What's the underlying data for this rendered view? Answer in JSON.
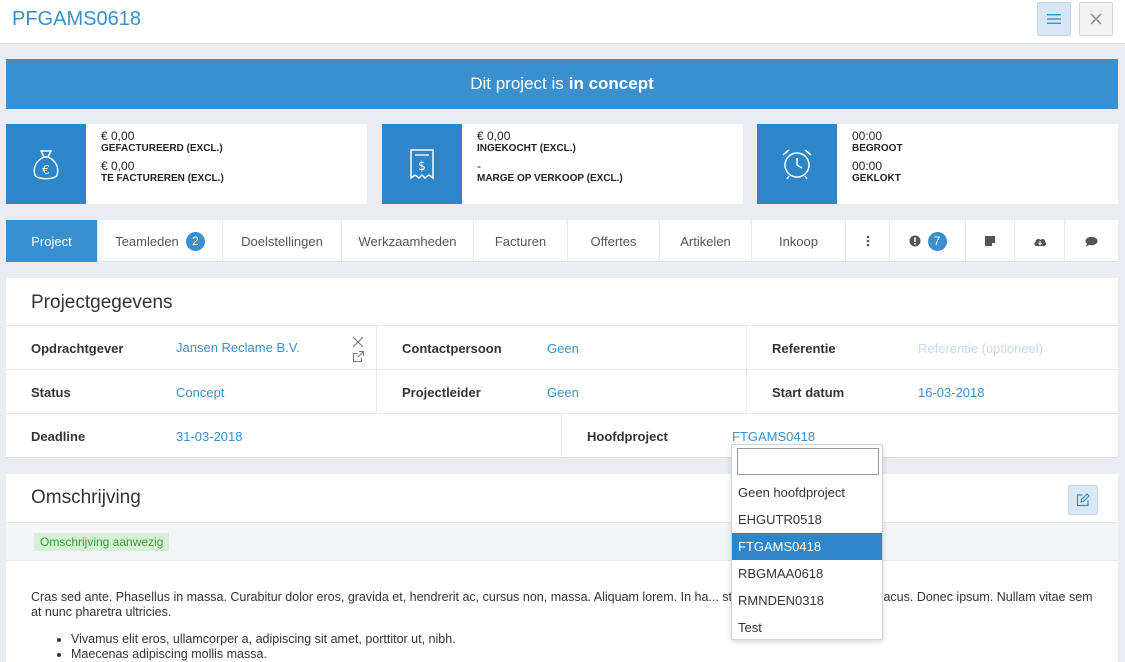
{
  "header": {
    "title": "PFGAMS0618"
  },
  "banner": {
    "prefix": "Dit project is",
    "status": "in concept"
  },
  "stats": [
    {
      "icon": "money-bag-icon",
      "rows": [
        {
          "value": "€ 0,00",
          "label": "GEFACTUREERD (EXCL.)"
        },
        {
          "value": "€ 0,00",
          "label": "TE FACTUREREN (EXCL.)"
        }
      ]
    },
    {
      "icon": "receipt-icon",
      "rows": [
        {
          "value": "€ 0,00",
          "label": "INGEKOCHT (EXCL.)"
        },
        {
          "value": "-",
          "label": "MARGE OP VERKOOP (EXCL.)"
        }
      ]
    },
    {
      "icon": "alarm-clock-icon",
      "rows": [
        {
          "value": "00:00",
          "label": "BEGROOT"
        },
        {
          "value": "00:00",
          "label": "GEKLOKT"
        }
      ]
    }
  ],
  "tabs": [
    {
      "label": "Project"
    },
    {
      "label": "Teamleden",
      "badge": "2"
    },
    {
      "label": "Doelstellingen"
    },
    {
      "label": "Werkzaamheden"
    },
    {
      "label": "Facturen"
    },
    {
      "label": "Offertes"
    },
    {
      "label": "Artikelen"
    },
    {
      "label": "Inkoop"
    }
  ],
  "tab_alert_badge": "7",
  "projectgegevens": {
    "title": "Projectgegevens",
    "opdrachtgever_label": "Opdrachtgever",
    "opdrachtgever_value": "Jansen Reclame B.V.",
    "contactpersoon_label": "Contactpersoon",
    "contactpersoon_value": "Geen",
    "referentie_label": "Referentie",
    "referentie_placeholder": "Referentie (optioneel)",
    "status_label": "Status",
    "status_value": "Concept",
    "projectleider_label": "Projectleider",
    "projectleider_value": "Geen",
    "startdatum_label": "Start datum",
    "startdatum_value": "16-03-2018",
    "deadline_label": "Deadline",
    "deadline_value": "31-03-2018",
    "hoofdproject_label": "Hoofdproject",
    "hoofdproject_value": "FTGAMS0418"
  },
  "dropdown": {
    "search_value": "",
    "options": [
      "Geen hoofdproject",
      "EHGUTR0518",
      "FTGAMS0418",
      "RBGMAA0618",
      "RMNDEN0318",
      "Test"
    ],
    "selected_index": 2
  },
  "omschrijving": {
    "title": "Omschrijving",
    "badge": "Omschrijving aanwezig",
    "paragraph": "Cras sed ante. Phasellus in massa. Curabitur dolor eros, gravida et, hendrerit ac, cursus non, massa. Aliquam lorem. In ha... st. Cras eu mauris. Quisque lacus. Donec ipsum. Nullam vitae sem at nunc pharetra ultricies.",
    "list": [
      "Vivamus elit eros, ullamcorper a, adipiscing sit amet, porttitor ut, nibh.",
      "Maecenas adipiscing mollis massa."
    ]
  },
  "colors": {
    "primary": "#3a8fcf",
    "icon_bg": "#2c86c7",
    "page_bg": "#e9edf2"
  }
}
